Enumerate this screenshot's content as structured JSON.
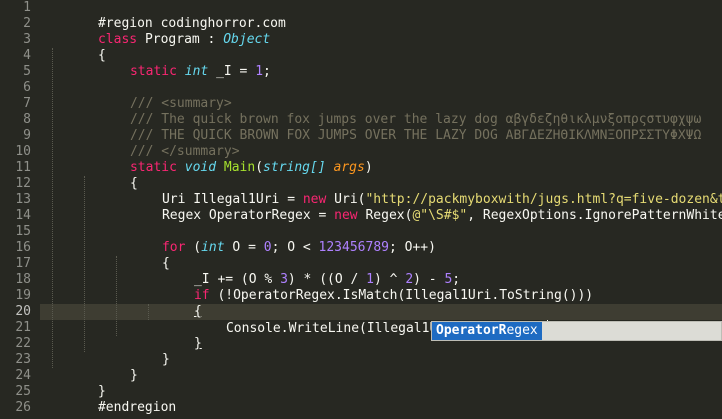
{
  "editor": {
    "line_numbers": [
      "1",
      "2",
      "3",
      "4",
      "5",
      "6",
      "7",
      "8",
      "9",
      "10",
      "11",
      "12",
      "13",
      "14",
      "15",
      "16",
      "17",
      "18",
      "19",
      "20",
      "21",
      "22",
      "23",
      "24",
      "25",
      "26"
    ],
    "active_line": "20",
    "lines": {
      "l1": [
        "#region codinghorror.com"
      ],
      "l2": [
        "class",
        " ",
        "Program",
        " : ",
        "Object"
      ],
      "l3": [
        "{"
      ],
      "l4": [
        "static",
        " ",
        "int",
        " _I = ",
        "1",
        ";"
      ],
      "l6": [
        "/// <summary>"
      ],
      "l7": [
        "/// The quick brown fox jumps over the lazy dog αβγδεζηθικλμνξοπρςστυφχψω"
      ],
      "l8": [
        "/// THE QUICK BROWN FOX JUMPS OVER THE LAZY DOG ΑΒΓΔΕΖΗΘΙΚΛΜΝΞΟΠΡΣΣΤΥΦΧΨΩ"
      ],
      "l9": [
        "/// </summary>"
      ],
      "l10": [
        "static",
        " ",
        "void",
        " ",
        "Main",
        "(",
        "string[]",
        " ",
        "args",
        ")"
      ],
      "l11": [
        "{"
      ],
      "l12": [
        "Uri Illegal1Uri = ",
        "new",
        " Uri(",
        "\"http://packmyboxwith/jugs.html?q=five-dozen&t=liquor\"",
        ");"
      ],
      "l13": [
        "Regex OperatorRegex = ",
        "new",
        " Regex(",
        "@\"\\S#$\"",
        ", RegexOptions.IgnorePatternWhitespace);"
      ],
      "l15": [
        "for",
        " (",
        "int",
        " O = ",
        "0",
        "; O < ",
        "123456789",
        "; O++)"
      ],
      "l16": [
        "{"
      ],
      "l17": [
        "_I += (O % ",
        "3",
        ") * ((O / ",
        "1",
        ") ^ ",
        "2",
        ") - ",
        "5",
        ";"
      ],
      "l18": [
        "if",
        " (!OperatorRegex.IsMatch(Illegal1Uri.ToString()))"
      ],
      "l19": [
        "{"
      ],
      "l20": [
        "Console.WriteLine(Illegal1Uri); OperatorR"
      ],
      "l21": [
        "}"
      ],
      "l22": [
        "}"
      ],
      "l23": [
        "}"
      ],
      "l24": [
        "}"
      ],
      "l25": [
        "#endregion"
      ]
    }
  },
  "autocomplete": {
    "match_part": "OperatorR",
    "rest_part": "egex"
  }
}
